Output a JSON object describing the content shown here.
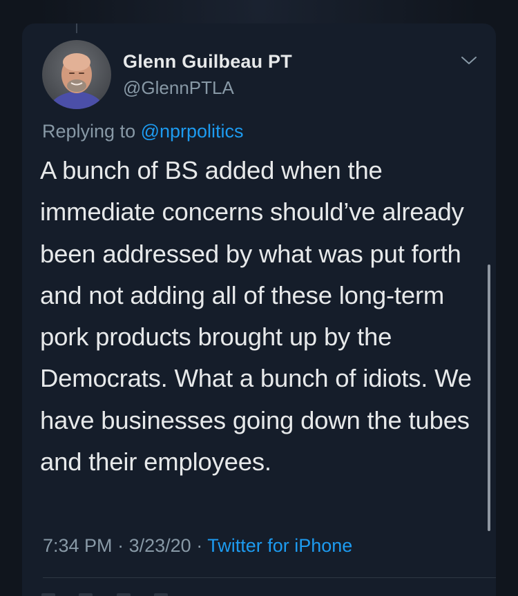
{
  "tweet": {
    "author": {
      "name": "Glenn Guilbeau PT",
      "handle": "@GlennPTLA"
    },
    "replying_prefix": "Replying to ",
    "replying_to": "@nprpolitics",
    "text": "A bunch of BS added when the immediate concerns should’ve already been addressed by what was put forth and not adding all of these long-term pork products brought up by the Democrats. What a bunch of idiots. We have businesses going down the tubes and their employees.",
    "time": "7:34 PM",
    "date": "3/23/20",
    "separator": "·",
    "source": "Twitter for iPhone"
  },
  "icons": {
    "more": "chevron-down-icon"
  },
  "colors": {
    "background": "#10151d",
    "card": "#151d2a",
    "accent": "#1d9bf0",
    "text": "#e7e9ea",
    "secondary": "#8899a6"
  }
}
